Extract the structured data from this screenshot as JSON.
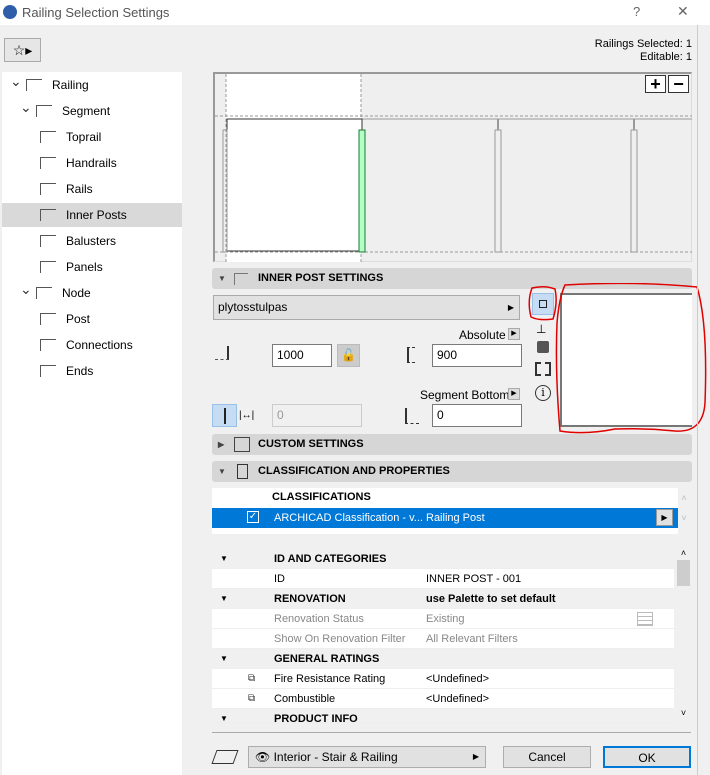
{
  "window": {
    "title": "Railing Selection Settings",
    "help": "?",
    "close": "✕"
  },
  "status": {
    "selected": "Railings Selected: 1",
    "editable": "Editable: 1"
  },
  "tree": [
    {
      "label": "Railing",
      "level": 0,
      "chev": true
    },
    {
      "label": "Segment",
      "level": 1,
      "chev": true
    },
    {
      "label": "Toprail",
      "level": 2
    },
    {
      "label": "Handrails",
      "level": 2
    },
    {
      "label": "Rails",
      "level": 2
    },
    {
      "label": "Inner Posts",
      "level": 2,
      "selected": true
    },
    {
      "label": "Balusters",
      "level": 2
    },
    {
      "label": "Panels",
      "level": 2
    },
    {
      "label": "Node",
      "level": 1,
      "chev": true
    },
    {
      "label": "Post",
      "level": 2
    },
    {
      "label": "Connections",
      "level": 2
    },
    {
      "label": "Ends",
      "level": 2
    }
  ],
  "preview": {
    "zoom_in": "+",
    "zoom_out": "−"
  },
  "inner_post": {
    "header": "INNER POST SETTINGS",
    "profile": "plytosstulpas",
    "absolute_label": "Absolute",
    "distance": "1000",
    "height": "900",
    "segment_bottom_label": "Segment Bottom",
    "offset": "0",
    "bottom_offset": "0"
  },
  "custom": {
    "header": "CUSTOM SETTINGS"
  },
  "classification": {
    "header": "CLASSIFICATION AND PROPERTIES",
    "list_title": "CLASSIFICATIONS",
    "item_name": "ARCHICAD Classification - v...",
    "item_value": "Railing Post"
  },
  "properties": [
    {
      "group": true,
      "name": "ID AND CATEGORIES",
      "value": ""
    },
    {
      "name": "ID",
      "value": "INNER POST - 001"
    },
    {
      "group": true,
      "name": "RENOVATION",
      "value": "use Palette to set default"
    },
    {
      "name": "Renovation Status",
      "value": "Existing",
      "dim": true
    },
    {
      "name": "Show On Renovation Filter",
      "value": "All Relevant Filters",
      "dim": true
    },
    {
      "group": true,
      "name": "GENERAL RATINGS",
      "value": ""
    },
    {
      "name": "Fire Resistance Rating",
      "value": "<Undefined>",
      "link": true
    },
    {
      "name": "Combustible",
      "value": "<Undefined>",
      "link": true
    },
    {
      "group": true,
      "name": "PRODUCT INFO",
      "value": ""
    }
  ],
  "footer": {
    "layer": "Interior - Stair & Railing",
    "cancel": "Cancel",
    "ok": "OK"
  },
  "colors": {
    "selection": "#0078d7",
    "accent_green": "#b3ffc8",
    "annotation": "#e00000"
  }
}
